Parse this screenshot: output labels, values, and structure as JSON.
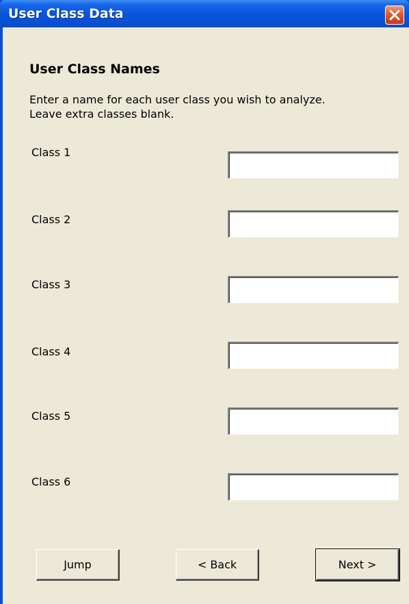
{
  "window": {
    "title": "User Class Data",
    "close_icon": "close-icon"
  },
  "content": {
    "heading": "User Class Names",
    "instruction_line1": "Enter a name for each user class you wish to analyze.",
    "instruction_line2": "Leave extra classes blank."
  },
  "classes": [
    {
      "label": "Class 1",
      "value": ""
    },
    {
      "label": "Class 2",
      "value": ""
    },
    {
      "label": "Class 3",
      "value": ""
    },
    {
      "label": "Class 4",
      "value": ""
    },
    {
      "label": "Class 5",
      "value": ""
    },
    {
      "label": "Class 6",
      "value": ""
    }
  ],
  "buttons": {
    "jump": "Jump",
    "back": "< Back",
    "next": "Next >"
  },
  "colors": {
    "titlebar": "#0a55dd",
    "dialog_background": "#ece9d8",
    "close_button": "#e2572f"
  }
}
